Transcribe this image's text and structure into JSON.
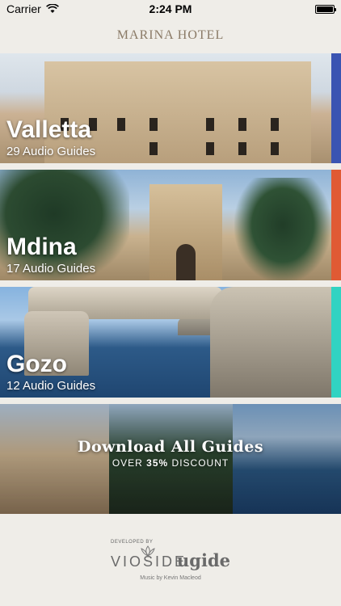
{
  "status_bar": {
    "carrier": "Carrier",
    "time": "2:24 PM",
    "icons": [
      "wifi-icon",
      "battery-icon"
    ]
  },
  "header": {
    "title": "MARINA HOTEL"
  },
  "cards": [
    {
      "title": "Valletta",
      "subtitle": "29 Audio Guides",
      "accent": "#3a54b2"
    },
    {
      "title": "Mdina",
      "subtitle": "17 Audio Guides",
      "accent": "#e05a34"
    },
    {
      "title": "Gozo",
      "subtitle": "12 Audio Guides",
      "accent": "#31d3c2"
    }
  ],
  "download": {
    "title": "Download All Guides",
    "subtitle_prefix": "OVER ",
    "discount": "35%",
    "subtitle_suffix": " DISCOUNT"
  },
  "footer": {
    "developed_by": "DEVELOPED BY",
    "vioside": "VIOSIDE",
    "ugide": "ugide",
    "music_credit": "Music by Kevin Macleod"
  }
}
